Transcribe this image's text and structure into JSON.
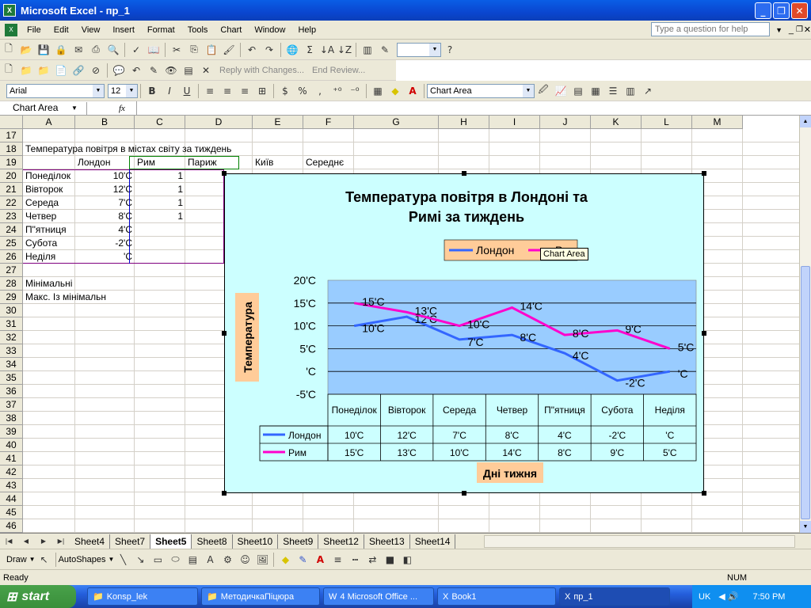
{
  "window": {
    "title": "Microsoft Excel - пр_1"
  },
  "menu": [
    "File",
    "Edit",
    "View",
    "Insert",
    "Format",
    "Tools",
    "Chart",
    "Window",
    "Help"
  ],
  "help_placeholder": "Type a question for help",
  "toolbar2": {
    "reply": "Reply with Changes...",
    "end_review": "End Review..."
  },
  "format_bar": {
    "font": "Arial",
    "size": "12",
    "chart_object": "Chart Area"
  },
  "name_box": "Chart Area",
  "fx": "fx",
  "columns": [
    "A",
    "B",
    "C",
    "D",
    "E",
    "F",
    "G",
    "H",
    "I",
    "J",
    "K",
    "L",
    "M"
  ],
  "rows": [
    "17",
    "18",
    "19",
    "20",
    "21",
    "22",
    "23",
    "24",
    "25",
    "26",
    "27",
    "28",
    "29",
    "30",
    "31",
    "32",
    "33",
    "34",
    "35",
    "36",
    "37",
    "38",
    "39",
    "40",
    "41",
    "42",
    "43",
    "44",
    "45",
    "46"
  ],
  "cells": {
    "r18": "Температура повітря в містах світу за тиждень",
    "r19": [
      "Лондон",
      "Рим",
      "Париж",
      "Київ",
      "Середнє"
    ],
    "days": [
      "Понеділок",
      "Вівторок",
      "Середа",
      "Четвер",
      "П\"ятниця",
      "Субота",
      "Неділя"
    ],
    "london": [
      "10'C",
      "12'C",
      "7'C",
      "8'C",
      "4'C",
      "-2'C",
      "'C"
    ],
    "rome_partial": [
      "1",
      "1",
      "1",
      "1"
    ],
    "r28": "Мінімальні",
    "r29": "Макс. Із мінімальн"
  },
  "sheets": [
    "Sheet4",
    "Sheet7",
    "Sheet5",
    "Sheet8",
    "Sheet10",
    "Sheet9",
    "Sheet12",
    "Sheet13",
    "Sheet14"
  ],
  "active_sheet": "Sheet5",
  "drawbar": {
    "draw": "Draw",
    "autoshapes": "AutoShapes"
  },
  "status": {
    "left": "Ready",
    "num": "NUM"
  },
  "taskbar": {
    "start": "start",
    "items": [
      "Konsp_lek",
      "МетодичкаПіцюра",
      "4 Microsoft Office ...",
      "Book1",
      "пр_1"
    ],
    "lang": "UK",
    "time": "7:50 PM"
  },
  "tooltip": "Chart Area",
  "chart_data": {
    "type": "line",
    "title": "Температура повітря в Лондоні та Римі за тиждень",
    "xlabel": "Дні тижня",
    "ylabel": "Температура",
    "categories": [
      "Понеділок",
      "Вівторок",
      "Середа",
      "Четвер",
      "П\"ятниця",
      "Субота",
      "Неділя"
    ],
    "yticks": [
      "20'C",
      "15'C",
      "10'C",
      "5'C",
      "'C",
      "-5'C"
    ],
    "ylim": [
      -5,
      20
    ],
    "legend_position": "top",
    "series": [
      {
        "name": "Лондон",
        "color": "#3366ff",
        "values": [
          10,
          12,
          7,
          8,
          4,
          -2,
          0
        ],
        "labels": [
          "10'C",
          "12'C",
          "7'C",
          "8'C",
          "4'C",
          "-2'C",
          "'C"
        ]
      },
      {
        "name": "Рим",
        "color": "#ff00cc",
        "values": [
          15,
          13,
          10,
          14,
          8,
          9,
          5
        ],
        "labels": [
          "15'C",
          "13'C",
          "10'C",
          "14'C",
          "8'C",
          "9'C",
          "5'C"
        ]
      }
    ],
    "legend_visible": [
      "Лондон",
      "Рим"
    ],
    "colors": {
      "chart_area": "#ccffff",
      "plot_area": "#99ccff",
      "axis_label_bg": "#ffcc99"
    }
  }
}
